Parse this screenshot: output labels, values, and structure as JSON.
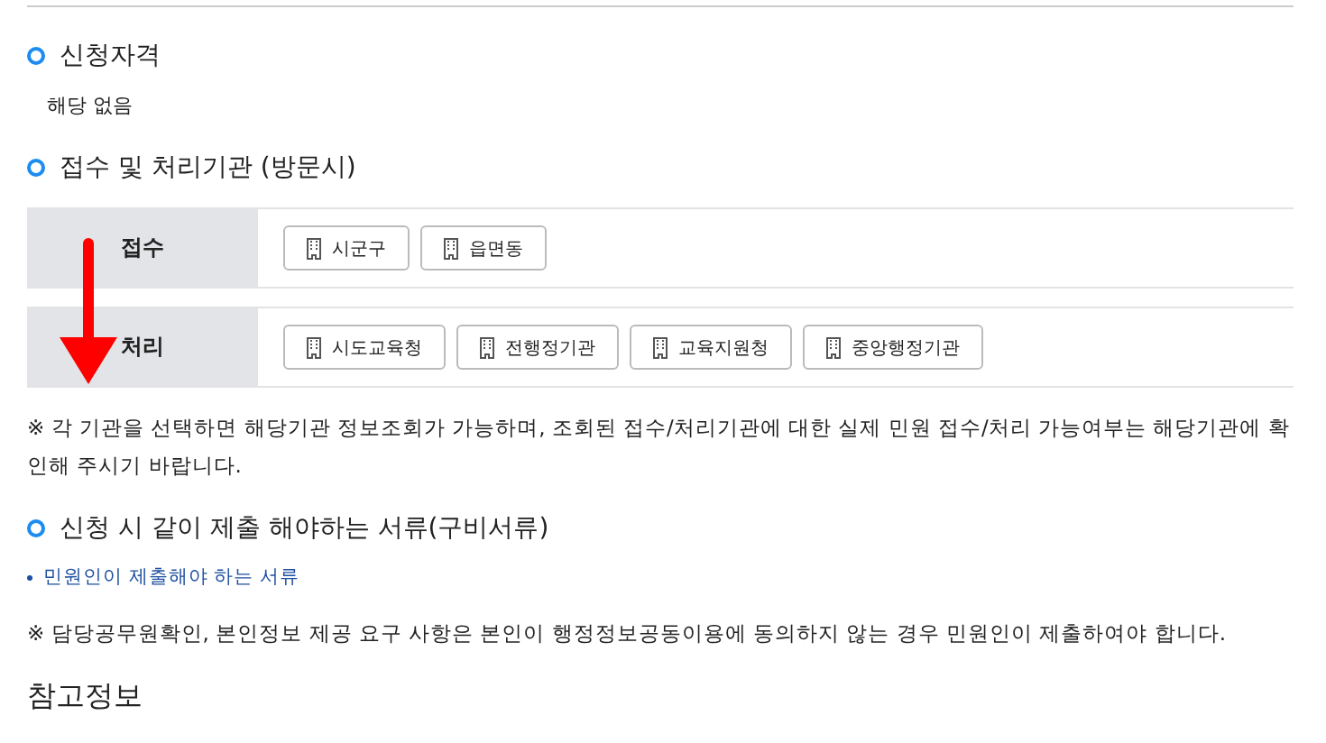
{
  "sections": [
    {
      "kind": "heading",
      "text": "신청자격"
    },
    {
      "kind": "text",
      "text": "해당 없음"
    },
    {
      "kind": "heading",
      "text": "접수 및 처리기관 (방문시)"
    },
    {
      "kind": "agencies",
      "rows": [
        {
          "label": "접수",
          "agencies": [
            "시군구",
            "읍면동"
          ]
        },
        {
          "label": "처리",
          "agencies": [
            "시도교육청",
            "전행정기관",
            "교육지원청",
            "중앙행정기관"
          ]
        }
      ]
    },
    {
      "kind": "note",
      "text": "※ 각 기관을 선택하면 해당기관 정보조회가 가능하며, 조회된 접수/처리기관에 대한 실제 민원 접수/처리 가능여부는 해당기관에 확인해 주시기 바랍니다."
    },
    {
      "kind": "heading",
      "text": "신청 시 같이 제출 해야하는 서류(구비서류)"
    },
    {
      "kind": "link",
      "text": "민원인이 제출해야 하는 서류"
    },
    {
      "kind": "note",
      "text": "※ 담당공무원확인, 본인정보 제공 요구 사항은 본인이 행정정보공동이용에 동의하지 않는 경우 민원인이 제출하여야 합니다."
    },
    {
      "kind": "title",
      "text": "참고정보"
    }
  ]
}
